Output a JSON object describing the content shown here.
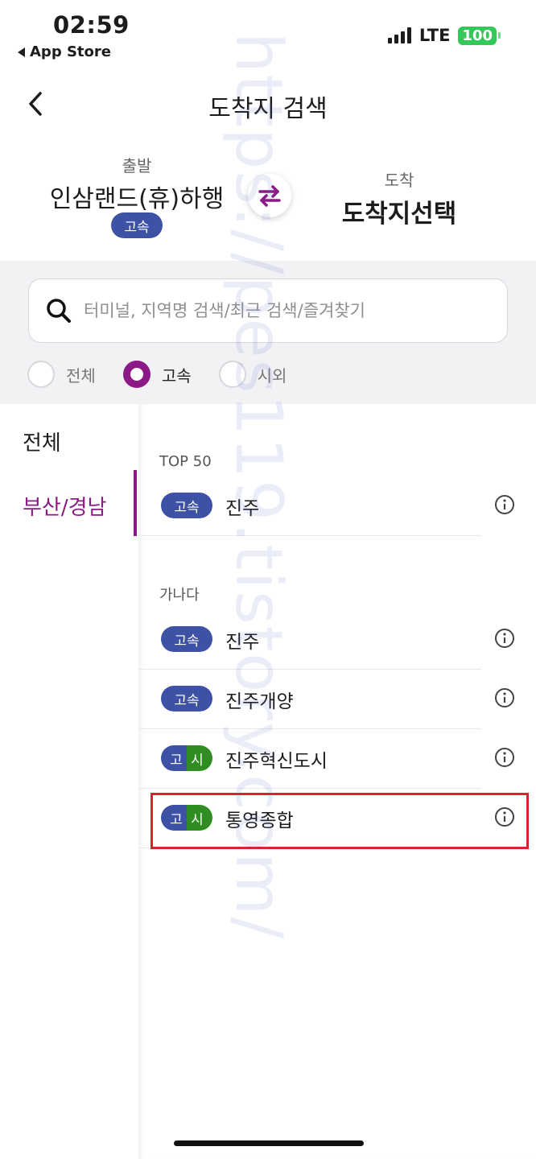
{
  "status_bar": {
    "time": "02:59",
    "back_app": "App Store",
    "network": "LTE",
    "battery": "100"
  },
  "header": {
    "title": "도착지 검색"
  },
  "route": {
    "departure_label": "출발",
    "departure_name": "인삼랜드(휴)하행",
    "departure_badge": "고속",
    "arrival_label": "도착",
    "arrival_name": "도착지선택"
  },
  "search": {
    "placeholder": "터미널, 지역명 검색/최근 검색/즐겨찾기"
  },
  "filters": [
    {
      "label": "전체",
      "selected": false
    },
    {
      "label": "고속",
      "selected": true
    },
    {
      "label": "시외",
      "selected": false
    }
  ],
  "regions": [
    {
      "label": "전체",
      "active": false
    },
    {
      "label": "부산/경남",
      "active": true
    }
  ],
  "sections": {
    "top": {
      "title": "TOP 50",
      "items": [
        {
          "badge": "고속",
          "name": "진주"
        }
      ]
    },
    "ganada": {
      "title": "가나다",
      "items": [
        {
          "badge": "고속",
          "name": "진주"
        },
        {
          "badge": "고속",
          "name": "진주개양"
        },
        {
          "badge_left": "고",
          "badge_right": "시",
          "name": "진주혁신도시"
        },
        {
          "badge_left": "고",
          "badge_right": "시",
          "name": "통영종합"
        }
      ]
    }
  },
  "watermark": "https://pes119.tistory.com/",
  "colors": {
    "accent": "#8b1a86",
    "express": "#3d52a5",
    "intercity": "#2f8d22",
    "highlight": "#d6232c"
  }
}
